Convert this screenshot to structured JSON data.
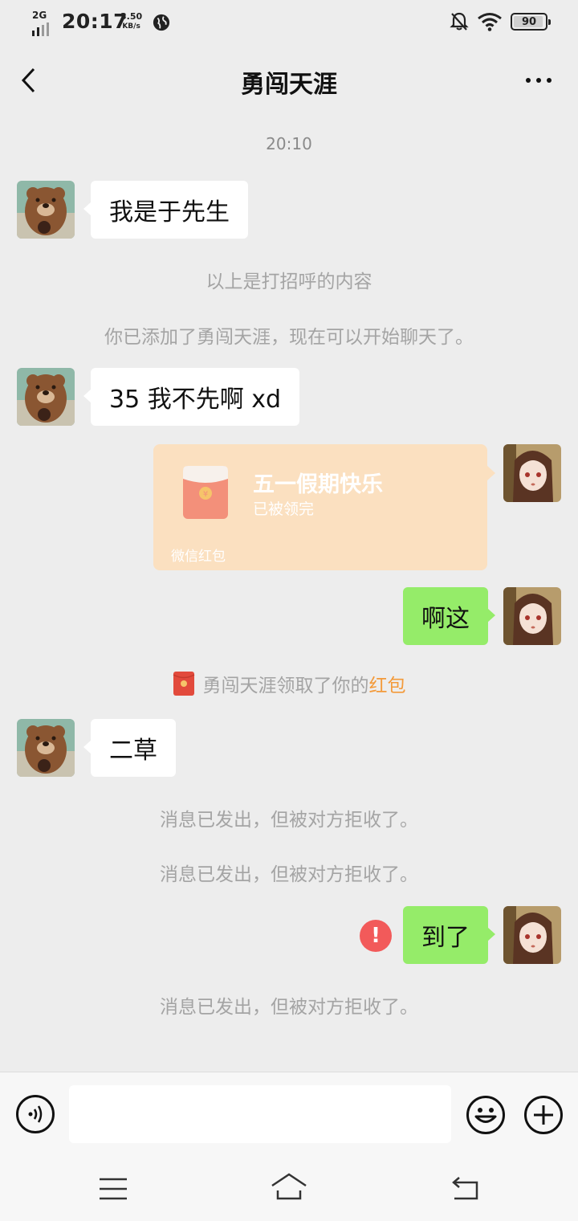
{
  "status_bar": {
    "network": "2G",
    "time": "20:17",
    "speed_value": "3.50",
    "speed_unit": "KB/s",
    "battery": "90",
    "icons": [
      "signal-icon",
      "globe-icon",
      "mute-bell-icon",
      "wifi-icon",
      "battery-icon"
    ]
  },
  "header": {
    "title": "勇闯天涯",
    "back_icon": "chevron-left-icon",
    "more_icon": "more-dots-icon"
  },
  "chat": {
    "timestamp": "20:10",
    "msg1": "我是于先生",
    "greeting_note": "以上是打招呼的内容",
    "added_note": "你已添加了勇闯天涯，现在可以开始聊天了。",
    "msg2": "35 我不先啊 xd",
    "red_packet": {
      "title": "五一假期快乐",
      "status": "已被领完",
      "footer": "微信红包"
    },
    "msg3": "啊这",
    "received_note_prefix": "勇闯天涯领取了你的",
    "received_note_highlight": "红包",
    "msg4": "二草",
    "rejected_note_1": "消息已发出，但被对方拒收了。",
    "rejected_note_2": "消息已发出，但被对方拒收了。",
    "msg5": "到了",
    "error_mark": "!",
    "rejected_note_3": "消息已发出，但被对方拒收了。"
  },
  "input_bar": {
    "value": "",
    "icons": [
      "voice-icon",
      "emoji-icon",
      "plus-icon"
    ]
  },
  "colors": {
    "background": "#ededed",
    "outgoing_bubble": "#95ec69",
    "incoming_bubble": "#ffffff",
    "red_packet": "#fbe0c0",
    "highlight": "#f39a3a",
    "error": "#f25a5a"
  }
}
